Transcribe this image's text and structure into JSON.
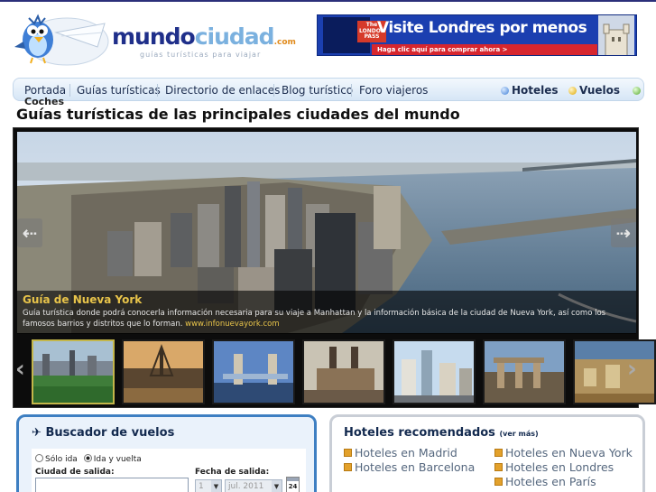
{
  "site": {
    "logo_main": "mundo",
    "logo_accent": "ciudad",
    "logo_tld": ".com",
    "tagline": "guías turísticas para viajar"
  },
  "banner": {
    "card_text": "The LONDON PASS",
    "title": "Visite Londres por menos",
    "subtitle": "Haga clic aquí para comprar ahora >"
  },
  "nav": {
    "items": [
      "Portada",
      "Guías turísticas",
      "Directorio de enlaces",
      "Blog turístico",
      "Foro viajeros"
    ],
    "right": [
      "Hoteles",
      "Vuelos"
    ],
    "overflow": "Coches"
  },
  "page": {
    "title": "Guías turísticas de las principales ciudades del mundo"
  },
  "slider": {
    "caption_title": "Guía de Nueva York",
    "caption_text": "Guía turística donde podrá conocerla información necesaria para su viaje a Manhattan y la información básica de la ciudad de Nueva York, así como los famosos barrios y distritos que lo forman.",
    "caption_link": "www.infonuevayork.com",
    "thumbnails": [
      "nueva-york",
      "paris",
      "londres",
      "praga",
      "barcelona",
      "madrid",
      "roma",
      "lisboa"
    ]
  },
  "flights": {
    "title": "Buscador de vuelos",
    "one_way": "Sólo ida",
    "round_trip": "Ida y vuelta",
    "departure_city_label": "Ciudad de salida:",
    "departure_date_label": "Fecha de salida:",
    "day_value": "1",
    "month_value": "jul. 2011",
    "calendar_day": "24"
  },
  "hotels": {
    "title": "Hoteles recomendados",
    "more": "(ver más)",
    "links": [
      "Hoteles en Madrid",
      "Hoteles en Nueva York",
      "Hoteles en Barcelona",
      "Hoteles en Londres",
      "Hoteles en París"
    ]
  },
  "colors": {
    "nav_bg": "#d6e6f6",
    "caption_accent": "#e8c44a",
    "flight_border": "#3e7fc2",
    "banner_bg": "#1b3fb0"
  }
}
